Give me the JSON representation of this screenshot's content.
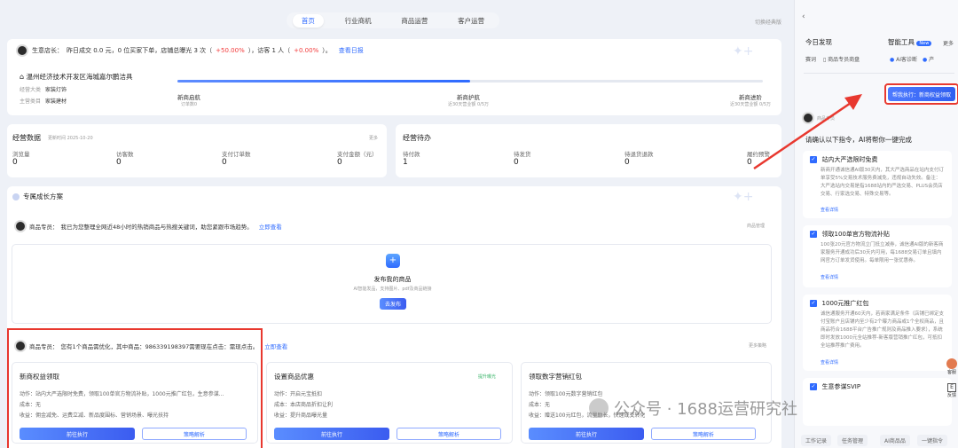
{
  "nav": {
    "tabs": [
      "首页",
      "行业商机",
      "商品运营",
      "客户运营"
    ],
    "active": 0,
    "switch_version": "切换经典版"
  },
  "banner": {
    "prefix": "生意店长：",
    "text1": "昨日成交 0.0 元，0 位买家下单，店铺总曝光 3 次（",
    "exposure_change": "+50.00%",
    "text2": "），访客 1 人（",
    "visitor_change": "+0.00%",
    "text3": "）。",
    "link": "查看日报"
  },
  "shop": {
    "name": "温州经济技术开发区海城嘉尔鹏洁具",
    "label_business": "经营大类",
    "business": "家装灯饰",
    "label_main": "主营类目",
    "main": "家装建材",
    "milestones": [
      {
        "title": "新商启航",
        "sub": "订单数0"
      },
      {
        "title": "新商护航",
        "sub": "近30天营业额 0/5万"
      },
      {
        "title": "新商进阶",
        "sub": "近30天营业额 0/5万"
      }
    ],
    "progress": 0.5
  },
  "ops": {
    "title": "经营数据",
    "updated": "更新时间 2025-10-20",
    "more": "更多",
    "stats": [
      {
        "label": "浏览量",
        "value": "0"
      },
      {
        "label": "访客数",
        "value": "0"
      },
      {
        "label": "支付订单数",
        "value": "0"
      },
      {
        "label": "支付金额（元）",
        "value": "0"
      }
    ]
  },
  "todo": {
    "title": "经营待办",
    "stats": [
      {
        "label": "待付款",
        "value": "1"
      },
      {
        "label": "待发货",
        "value": "0"
      },
      {
        "label": "待退货退款",
        "value": "0"
      },
      {
        "label": "履约预警",
        "value": "0"
      }
    ]
  },
  "growth": {
    "title": "专属成长方案",
    "notice1": {
      "prefix": "商品专员：",
      "text": "我已为您整理全网近48小时的热销商品与热搜关键词，助您紧跟市场趋势。",
      "link": "立即查看",
      "right": "商品管理"
    },
    "publish": {
      "title": "发布我的商品",
      "sub": "AI智能发品，支持图片、pdf及商品链接",
      "button": "去发布"
    },
    "notice2": {
      "prefix": "商品专员：",
      "text": "您有1个商品需优化，其中商品：986339198397需要现在点击：需现点击。",
      "link": "立即查看",
      "right": "更多策略"
    },
    "tasks": [
      {
        "title": "新商权益领取",
        "badge": "",
        "line1": "动作：站内大严选限时免费，领取100单官方物流补贴，1000元推广红包，生意参谋...",
        "line2": "成本：无",
        "line3": "收益：佣金减免、运费立减、新品度围标、营销场景、曝光扶持",
        "primary": "前往执行",
        "secondary": "策略解析"
      },
      {
        "title": "设置商品优惠",
        "badge": "提升曝光",
        "line1": "动作：开启元宝抵扣",
        "line2": "成本：本店商品折扣让利",
        "line3": "收益：提升商品曝光量",
        "primary": "前往执行",
        "secondary": "策略解析"
      },
      {
        "title": "领取数字营销红包",
        "badge": "",
        "line1": "动作：领取100元数字营销红包",
        "line2": "成本：无",
        "line3": "收益：赠送100元红包，流量助长，快速成交转化",
        "primary": "前往执行",
        "secondary": "策略解析"
      }
    ]
  },
  "panel": {
    "today_title": "今日发现",
    "today_items": [
      "赛词",
      "商品专员商盘"
    ],
    "tools_title": "智能工具",
    "tools_badge": "New",
    "tools_more": "更多",
    "tools_items": [
      "AI客诊断",
      "产"
    ],
    "exec_button": "帮我执行：新商权益领取",
    "agent_name": "商品专员",
    "confirm_title": "请确认以下指令，AI将帮你一键完成",
    "items": [
      {
        "title": "站内大严选限时免费",
        "desc": "新商开通诚信通AI版30天内，其大严选商品在站内支付订单享受5%交易技术服务费减免，违规自动失效。备注：大严选站内交易是指1688站内的严选交易、PLUS会员店交易、行家选交易、特殊交易等。",
        "link": "查看详情"
      },
      {
        "title": "领取100单官方物流补贴",
        "desc": "100张20元官方物流立门抵立减券，诚信通AI版的新客商家服务开通成功后30天内可用，每1688交易订单且填内网官方订单发货使用。每单限用一张优惠券。",
        "link": "查看详情"
      },
      {
        "title": "1000元推广红包",
        "desc": "诚信通服务开通60天内，若商家满足条件（店铺已绑定支付宝账户且店铺内至少有2个曝力商品或1个全权商品，且商品符合1688平台广告推广规则及商品推入要求），系统即时发放1000元全站推荐-新客版营销推广红包，可抵扣全站推荐推广费用。",
        "link": "查看详情"
      },
      {
        "title": "生意参谋SVIP",
        "desc": "",
        "link": ""
      }
    ],
    "bottom_tabs": [
      "工作记录",
      "任务管理",
      "AI商品品",
      "一键指令",
      "1688"
    ],
    "side_icons": [
      "客服",
      "反馈"
    ]
  },
  "watermark": "公众号 · 1688运营研究社"
}
